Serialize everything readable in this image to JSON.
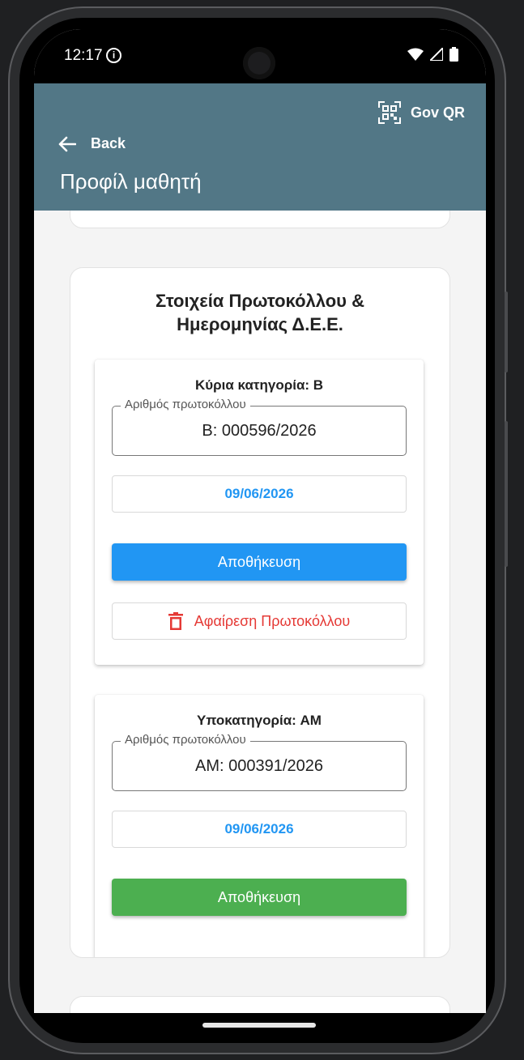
{
  "status_bar": {
    "time": "12:17"
  },
  "header": {
    "qr_label": "Gov QR",
    "back_label": "Back",
    "title": "Προφίλ μαθητή"
  },
  "card": {
    "title": "Στοιχεία Πρωτοκόλλου & Ημερομηνίας Δ.Ε.Ε.",
    "sections": [
      {
        "title": "Κύρια κατηγορία: B",
        "field_label": "Αριθμός πρωτοκόλλου",
        "field_value": "B: 000596/2026",
        "date": "09/06/2026",
        "save_label": "Αποθήκευση",
        "save_color": "#2196f3",
        "remove_label": "Αφαίρεση Πρωτοκόλλου"
      },
      {
        "title": "Υποκατηγορία: AM",
        "field_label": "Αριθμός πρωτοκόλλου",
        "field_value": "AM: 000391/2026",
        "date": "09/06/2026",
        "save_label": "Αποθήκευση",
        "save_color": "#4caf50"
      }
    ]
  },
  "colors": {
    "appbar": "#527786",
    "accent_blue": "#2196f3",
    "accent_green": "#4caf50",
    "danger": "#e53935"
  }
}
